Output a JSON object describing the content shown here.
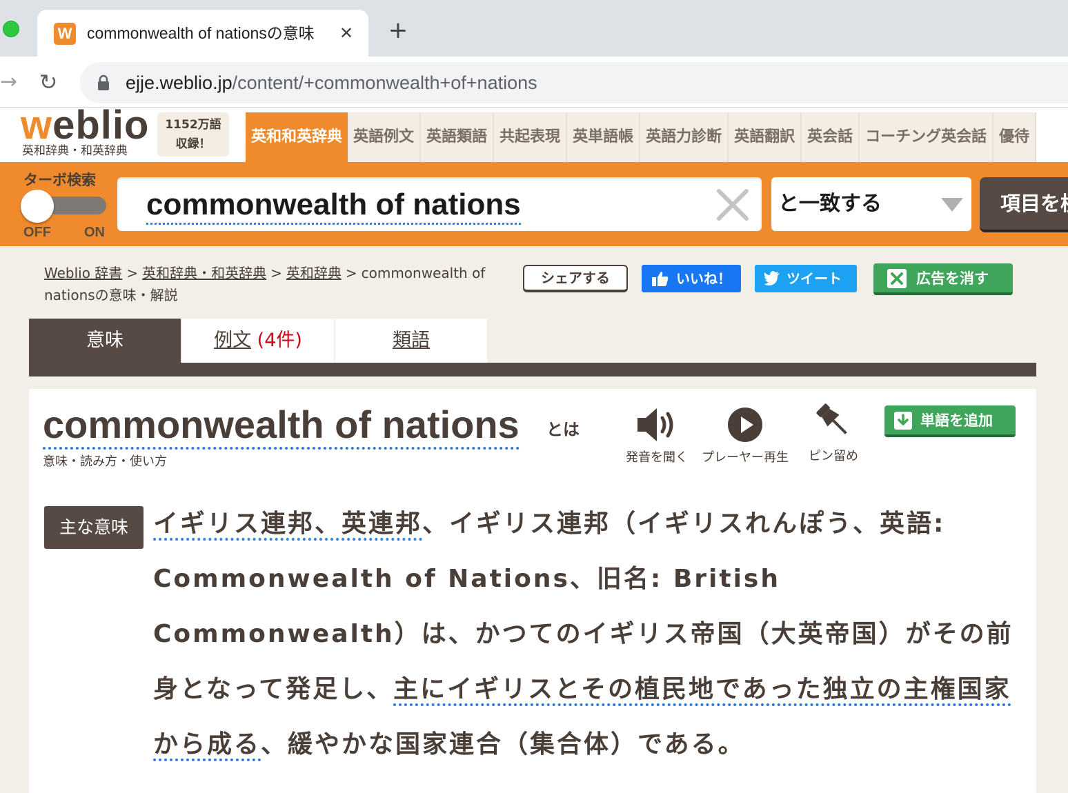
{
  "browser": {
    "tab_favicon": "W",
    "tab_title": "commonwealth of nationsの意味",
    "tab_close": "✕",
    "new_tab": "+",
    "url_host": "ejje.weblio.jp",
    "url_path": "/content/+commonwealth+of+nations"
  },
  "header": {
    "logo_text": "weblio",
    "logo_sub": "英和辞典・和英辞典",
    "word_count_line1": "1152万語",
    "word_count_line2": "収録！",
    "nav": [
      {
        "label": "英和和英辞典",
        "active": true
      },
      {
        "label": "英語例文"
      },
      {
        "label": "英語類語"
      },
      {
        "label": "共起表現"
      },
      {
        "label": "英単語帳"
      },
      {
        "label": "英語力診断"
      },
      {
        "label": "英語翻訳"
      },
      {
        "label": "英会話"
      },
      {
        "label": "コーチング英会話"
      },
      {
        "label": "優待"
      }
    ]
  },
  "search": {
    "turbo_label": "ターボ検索",
    "toggle_off": "OFF",
    "toggle_on": "ON",
    "query": "commonwealth of nations",
    "match_mode": "と一致する",
    "submit_label": "項目を検索"
  },
  "breadcrumb": {
    "items": [
      "Weblio 辞書",
      "英和辞典・和英辞典",
      "英和辞典"
    ],
    "current": "commonwealth of nationsの意味・解説",
    "separator": ">"
  },
  "social": {
    "share": "シェアする",
    "like": "いいね！",
    "tweet": "ツイート",
    "remove_ads": "広告を消す"
  },
  "tabs": {
    "meaning": "意味",
    "examples": "例文",
    "examples_count": "(4件)",
    "synonyms": "類語"
  },
  "entry": {
    "headword": "commonwealth of nations",
    "headword_suffix": "とは",
    "subtitle": "意味・読み方・使い方",
    "tools": {
      "sound": "発音を聞く",
      "player": "プレーヤー再生",
      "pin": "ピン留め"
    },
    "add_word": "単語を追加",
    "meaning_badge": "主な意味",
    "meaning_part1": "イギリス連邦、英連邦",
    "meaning_part2": "、イギリス連邦（イギリスれんぽう、英語: Commonwealth of Nations、旧名: British Commonwealth）は、かつてのイギリス帝国（大英帝国）がその前身となって発足し、",
    "meaning_part3": "主にイギリスとその植民地であった独立の主権国家から成る",
    "meaning_part4": "、緩やかな国家連合（集合体）である。"
  },
  "colors": {
    "brand_orange": "#ef8a2d",
    "brand_brown": "#574943",
    "accent_green": "#3fa55b",
    "facebook_blue": "#1877f2",
    "twitter_blue": "#1da1f2",
    "underline_blue": "#2f7fe0"
  }
}
